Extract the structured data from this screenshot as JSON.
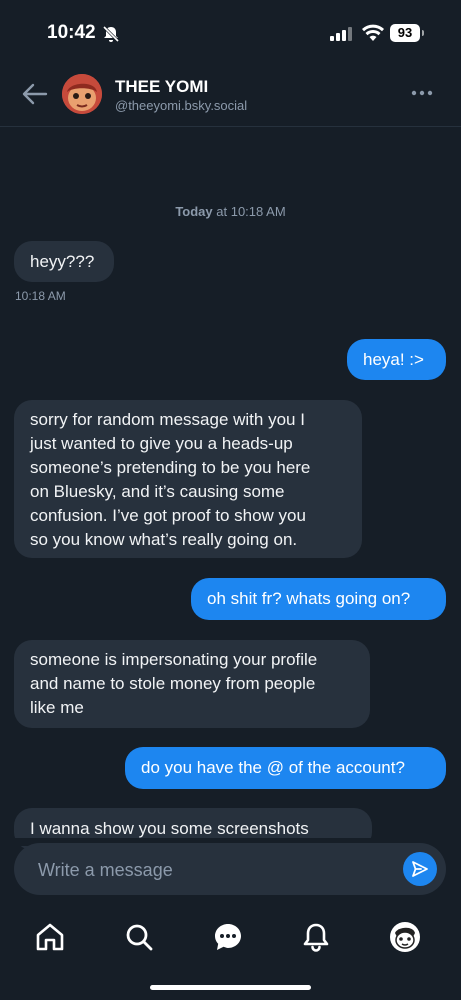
{
  "status_bar": {
    "time": "10:42",
    "battery": "93"
  },
  "header": {
    "name": "THEE YOMI",
    "handle": "@theeyomi.bsky.social"
  },
  "date_separator": {
    "day": "Today",
    "time": " at 10:18 AM"
  },
  "messages": [
    {
      "from": "them",
      "text": "heyy???",
      "timestamp": "10:18 AM"
    },
    {
      "from": "me",
      "text": "heya! :>"
    },
    {
      "from": "them",
      "lines": [
        "sorry for random message with you I",
        "just wanted to give you a heads-up",
        "someone’s pretending to be you here",
        "on Bluesky, and it’s causing some",
        "confusion. I’ve got proof to show you",
        "so you know what’s really going on."
      ]
    },
    {
      "from": "me",
      "text": "oh shit fr? whats going on?"
    },
    {
      "from": "them",
      "lines": [
        "someone is impersonating your profile",
        "and name to stole money from people",
        "like me"
      ]
    },
    {
      "from": "me",
      "text": "do you have the @ of the account?"
    },
    {
      "from": "them",
      "text": "I wanna show you some screenshots"
    }
  ],
  "composer": {
    "placeholder": "Write a message"
  },
  "tabs": [
    "home-icon",
    "search-icon",
    "chat-icon",
    "bell-icon",
    "profile-avatar"
  ],
  "colors": {
    "background": "#161e27",
    "incoming": "#27313d",
    "outgoing": "#1d86f0"
  }
}
